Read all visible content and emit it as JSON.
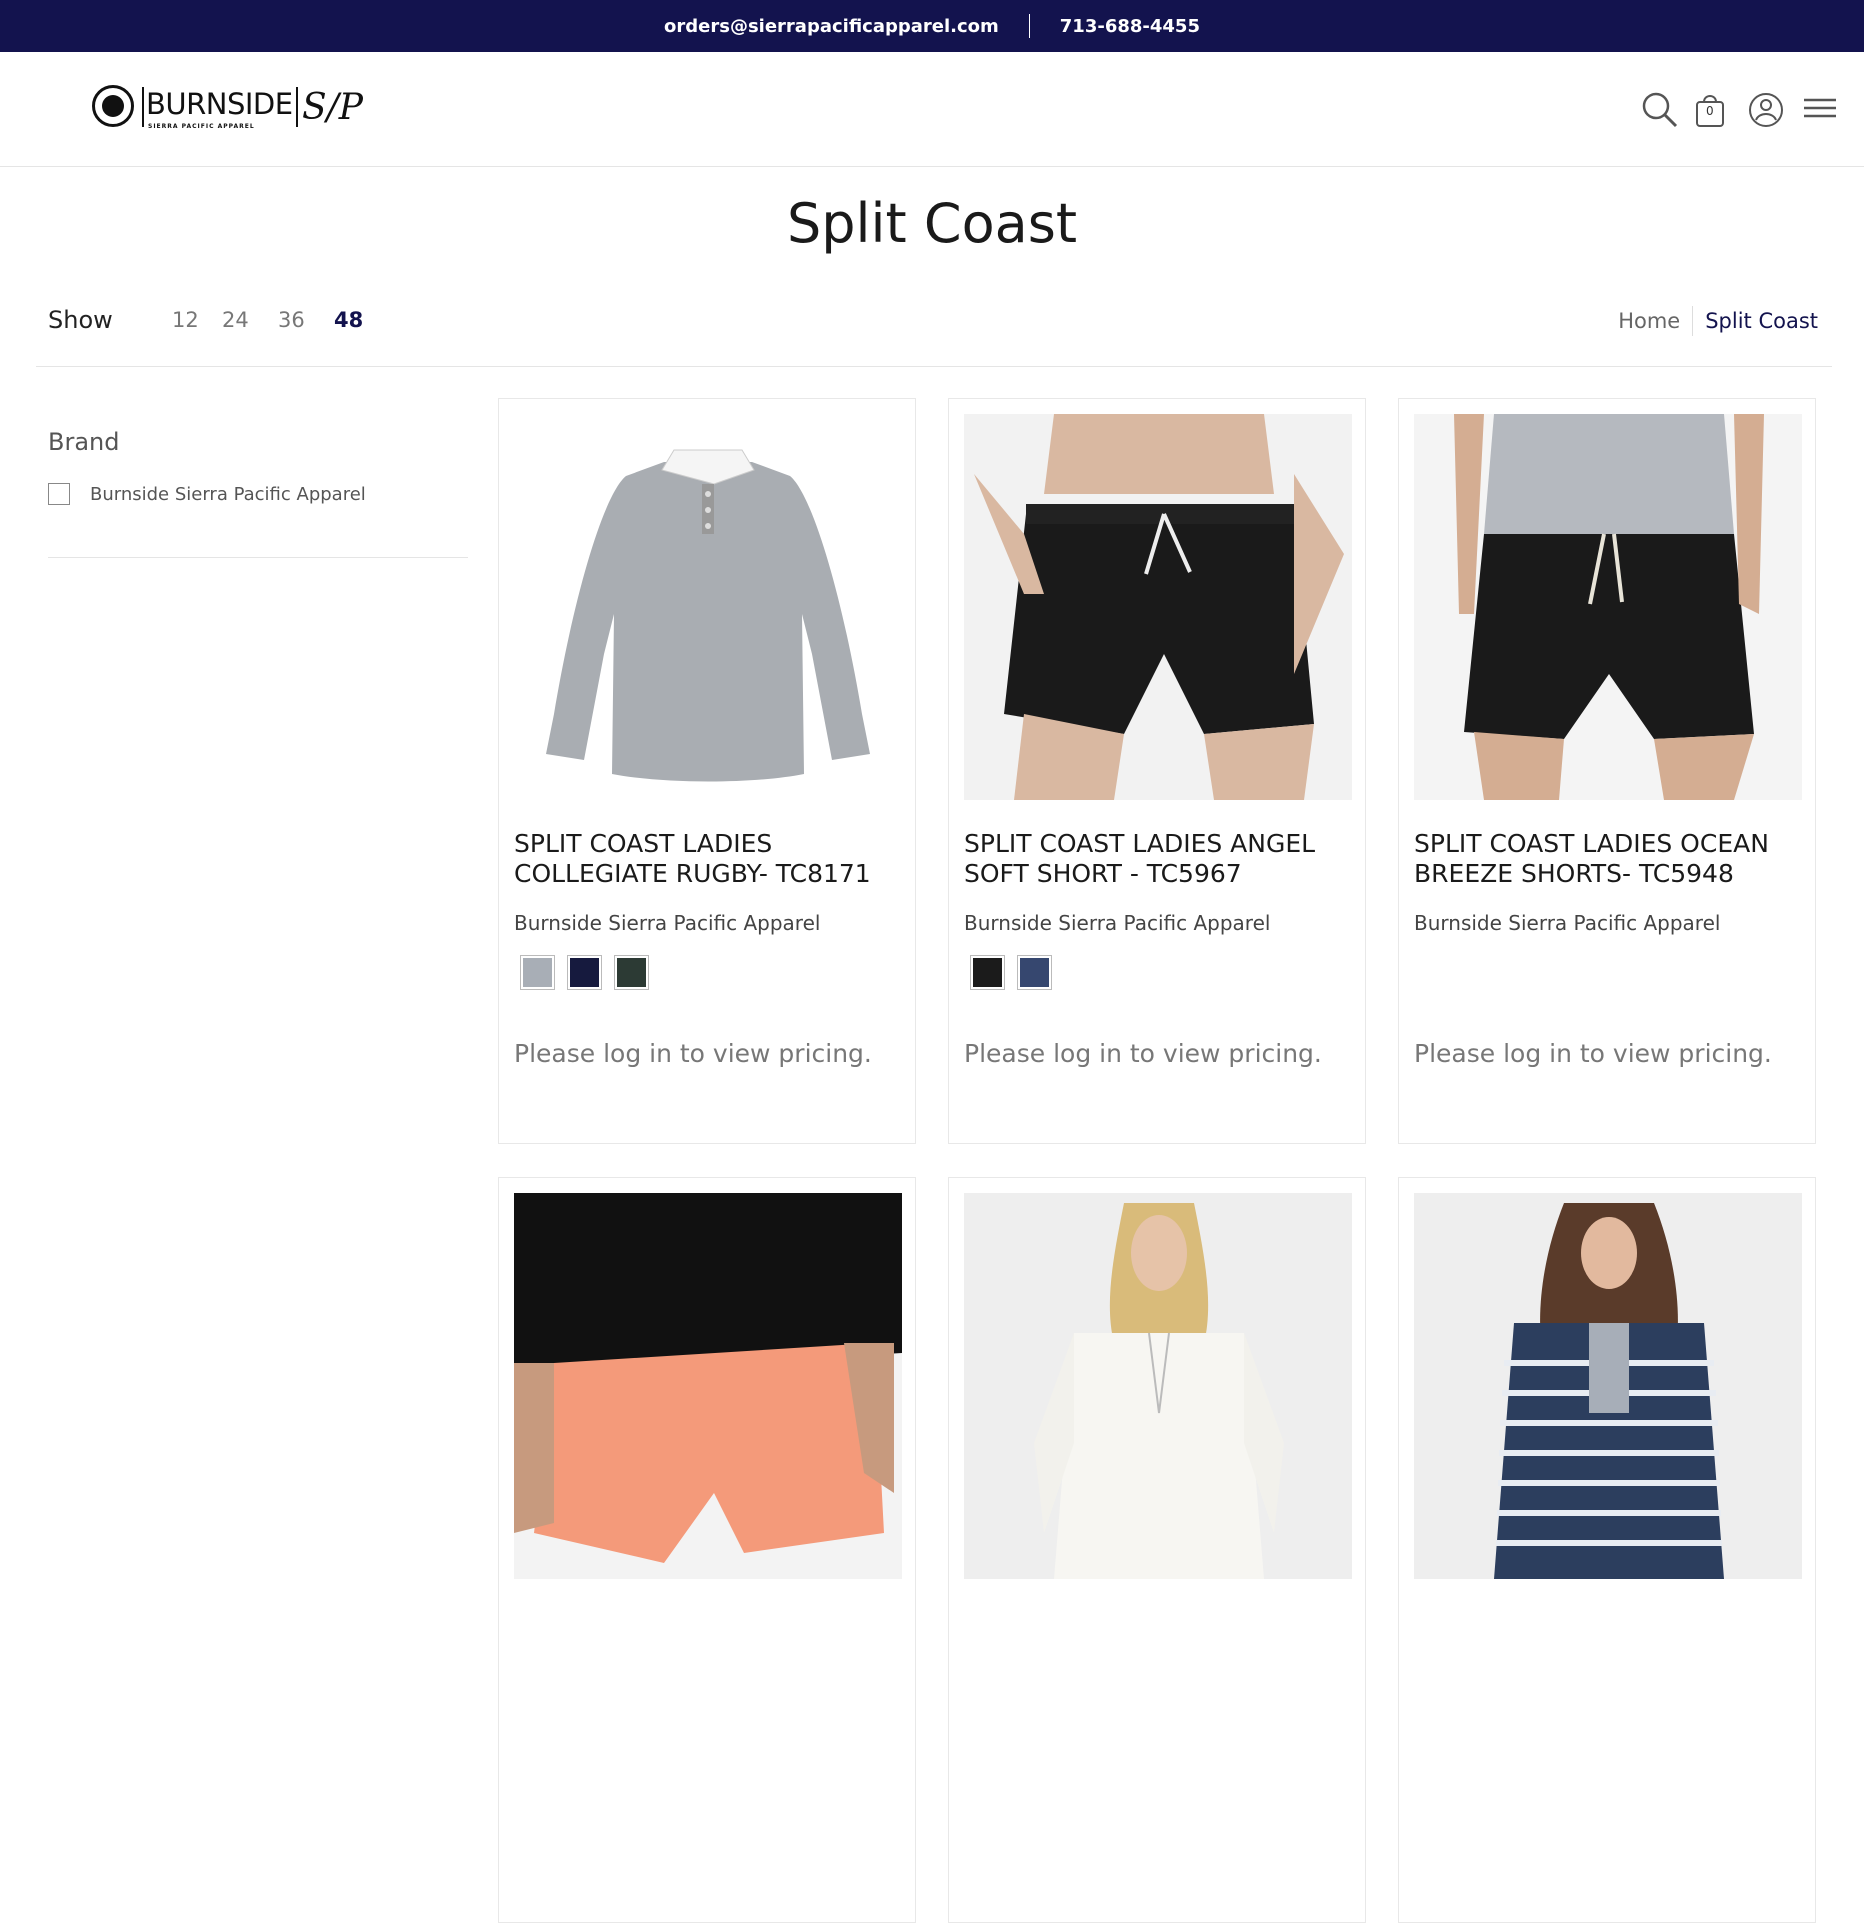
{
  "topbar": {
    "email": "orders@sierrapacificapparel.com",
    "phone": "713-688-4455"
  },
  "logo": {
    "wordmark": "BURNSIDE",
    "subline": "SIERRA PACIFIC APPAREL",
    "monogram": "S/P"
  },
  "header": {
    "icons": [
      "search-icon",
      "cart-icon",
      "account-icon",
      "menu-icon"
    ],
    "cart_count": "0"
  },
  "page": {
    "title": "Split Coast"
  },
  "show": {
    "label": "Show",
    "options": [
      "12",
      "24",
      "36",
      "48"
    ],
    "selected": "48"
  },
  "breadcrumb": {
    "home": "Home",
    "current": "Split Coast"
  },
  "sidebar": {
    "title": "Brand",
    "filters": [
      {
        "label": "Burnside Sierra Pacific Apparel",
        "checked": false
      }
    ]
  },
  "products": [
    {
      "title": "SPLIT COAST LADIES COLLEGIATE RUGBY- TC8171",
      "vendor": "Burnside Sierra Pacific Apparel",
      "swatches": [
        "#a8aeb6",
        "#161a3e",
        "#2c3a34"
      ],
      "price_note": "Please log in to view pricing."
    },
    {
      "title": "SPLIT COAST LADIES ANGEL SOFT SHORT - TC5967",
      "vendor": "Burnside Sierra Pacific Apparel",
      "swatches": [
        "#1b1b1b",
        "#36476f"
      ],
      "price_note": "Please log in to view pricing."
    },
    {
      "title": "SPLIT COAST LADIES OCEAN BREEZE SHORTS- TC5948",
      "vendor": "Burnside Sierra Pacific Apparel",
      "swatches": [],
      "price_note": "Please log in to view pricing."
    },
    {
      "title": "",
      "vendor": "",
      "swatches": [],
      "price_note": ""
    },
    {
      "title": "",
      "vendor": "",
      "swatches": [],
      "price_note": ""
    },
    {
      "title": "",
      "vendor": "",
      "swatches": [],
      "price_note": ""
    }
  ],
  "colors": {
    "topbar": "#13134e",
    "accent": "#13134e"
  }
}
